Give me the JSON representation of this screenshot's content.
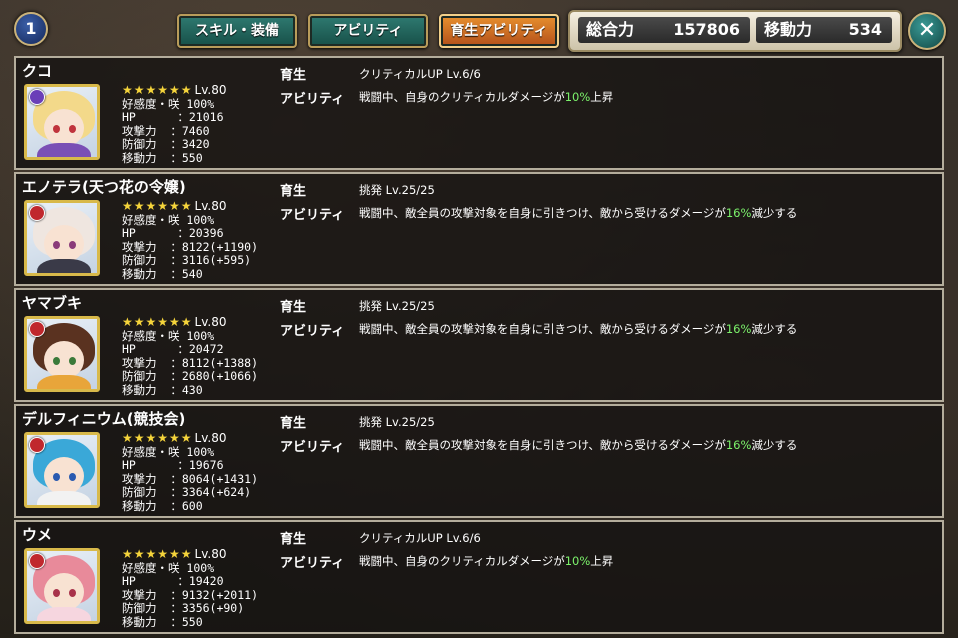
{
  "header": {
    "page_number": "1",
    "tabs": [
      {
        "label": "スキル・装備"
      },
      {
        "label": "アビリティ"
      },
      {
        "label": "育生アビリティ"
      }
    ],
    "stats": {
      "total_power_label": "総合力",
      "total_power_value": "157806",
      "movement_label": "移動力",
      "movement_value": "534"
    },
    "close_icon": "close-icon"
  },
  "labels": {
    "ikusei": "育生",
    "ability": "アビリティ"
  },
  "characters": [
    {
      "name": "クコ",
      "element_color": "#6a3fb8",
      "portrait": {
        "hair": "#f3d98a",
        "eyes": "#c0333c",
        "outfit": "#7a4fb5"
      },
      "stars": "★★★★★★",
      "level": "Lv.80",
      "affinity": "好感度・咲 100%",
      "hp": "HP      ：21016",
      "atk": "攻撃力  ：7460",
      "def": "防御力  ：3420",
      "mov": "移動力  ：550",
      "ikusei_text": "クリティカルUP Lv.6/6",
      "ability_pre": "戦闘中、自身のクリティカルダメージが",
      "ability_hl": "10%",
      "ability_post": "上昇"
    },
    {
      "name": "エノテラ(天つ花の令嬢)",
      "element_color": "#c0282d",
      "portrait": {
        "hair": "#efe6e0",
        "eyes": "#8a3b7a",
        "outfit": "#3a3a48"
      },
      "stars": "★★★★★★",
      "level": "Lv.80",
      "affinity": "好感度・咲 100%",
      "hp": "HP      ：20396",
      "atk": "攻撃力  ：8122(+1190)",
      "def": "防御力  ：3116(+595)",
      "mov": "移動力  ：540",
      "ikusei_text": "挑発 Lv.25/25",
      "ability_pre": "戦闘中、敵全員の攻撃対象を自身に引きつけ、敵から受けるダメージが",
      "ability_hl": "16%",
      "ability_post": "減少する"
    },
    {
      "name": "ヤマブキ",
      "element_color": "#c0282d",
      "portrait": {
        "hair": "#5a3220",
        "eyes": "#3b7a3a",
        "outfit": "#e8a53a"
      },
      "stars": "★★★★★★",
      "level": "Lv.80",
      "affinity": "好感度・咲 100%",
      "hp": "HP      ：20472",
      "atk": "攻撃力  ：8112(+1388)",
      "def": "防御力  ：2680(+1066)",
      "mov": "移動力  ：430",
      "ikusei_text": "挑発 Lv.25/25",
      "ability_pre": "戦闘中、敵全員の攻撃対象を自身に引きつけ、敵から受けるダメージが",
      "ability_hl": "16%",
      "ability_post": "減少する"
    },
    {
      "name": "デルフィニウム(競技会)",
      "element_color": "#c0282d",
      "portrait": {
        "hair": "#3aa8d8",
        "eyes": "#2a5ab0",
        "outfit": "#f2f2f2"
      },
      "stars": "★★★★★★",
      "level": "Lv.80",
      "affinity": "好感度・咲 100%",
      "hp": "HP      ：19676",
      "atk": "攻撃力  ：8064(+1431)",
      "def": "防御力  ：3364(+624)",
      "mov": "移動力  ：600",
      "ikusei_text": "挑発 Lv.25/25",
      "ability_pre": "戦闘中、敵全員の攻撃対象を自身に引きつけ、敵から受けるダメージが",
      "ability_hl": "16%",
      "ability_post": "減少する"
    },
    {
      "name": "ウメ",
      "element_color": "#c0282d",
      "portrait": {
        "hair": "#e88a9a",
        "eyes": "#a8324a",
        "outfit": "#f6d6df"
      },
      "stars": "★★★★★★",
      "level": "Lv.80",
      "affinity": "好感度・咲 100%",
      "hp": "HP      ：19420",
      "atk": "攻撃力  ：9132(+2011)",
      "def": "防御力  ：3356(+90)",
      "mov": "移動力  ：550",
      "ikusei_text": "クリティカルUP Lv.6/6",
      "ability_pre": "戦闘中、自身のクリティカルダメージが",
      "ability_hl": "10%",
      "ability_post": "上昇"
    }
  ]
}
